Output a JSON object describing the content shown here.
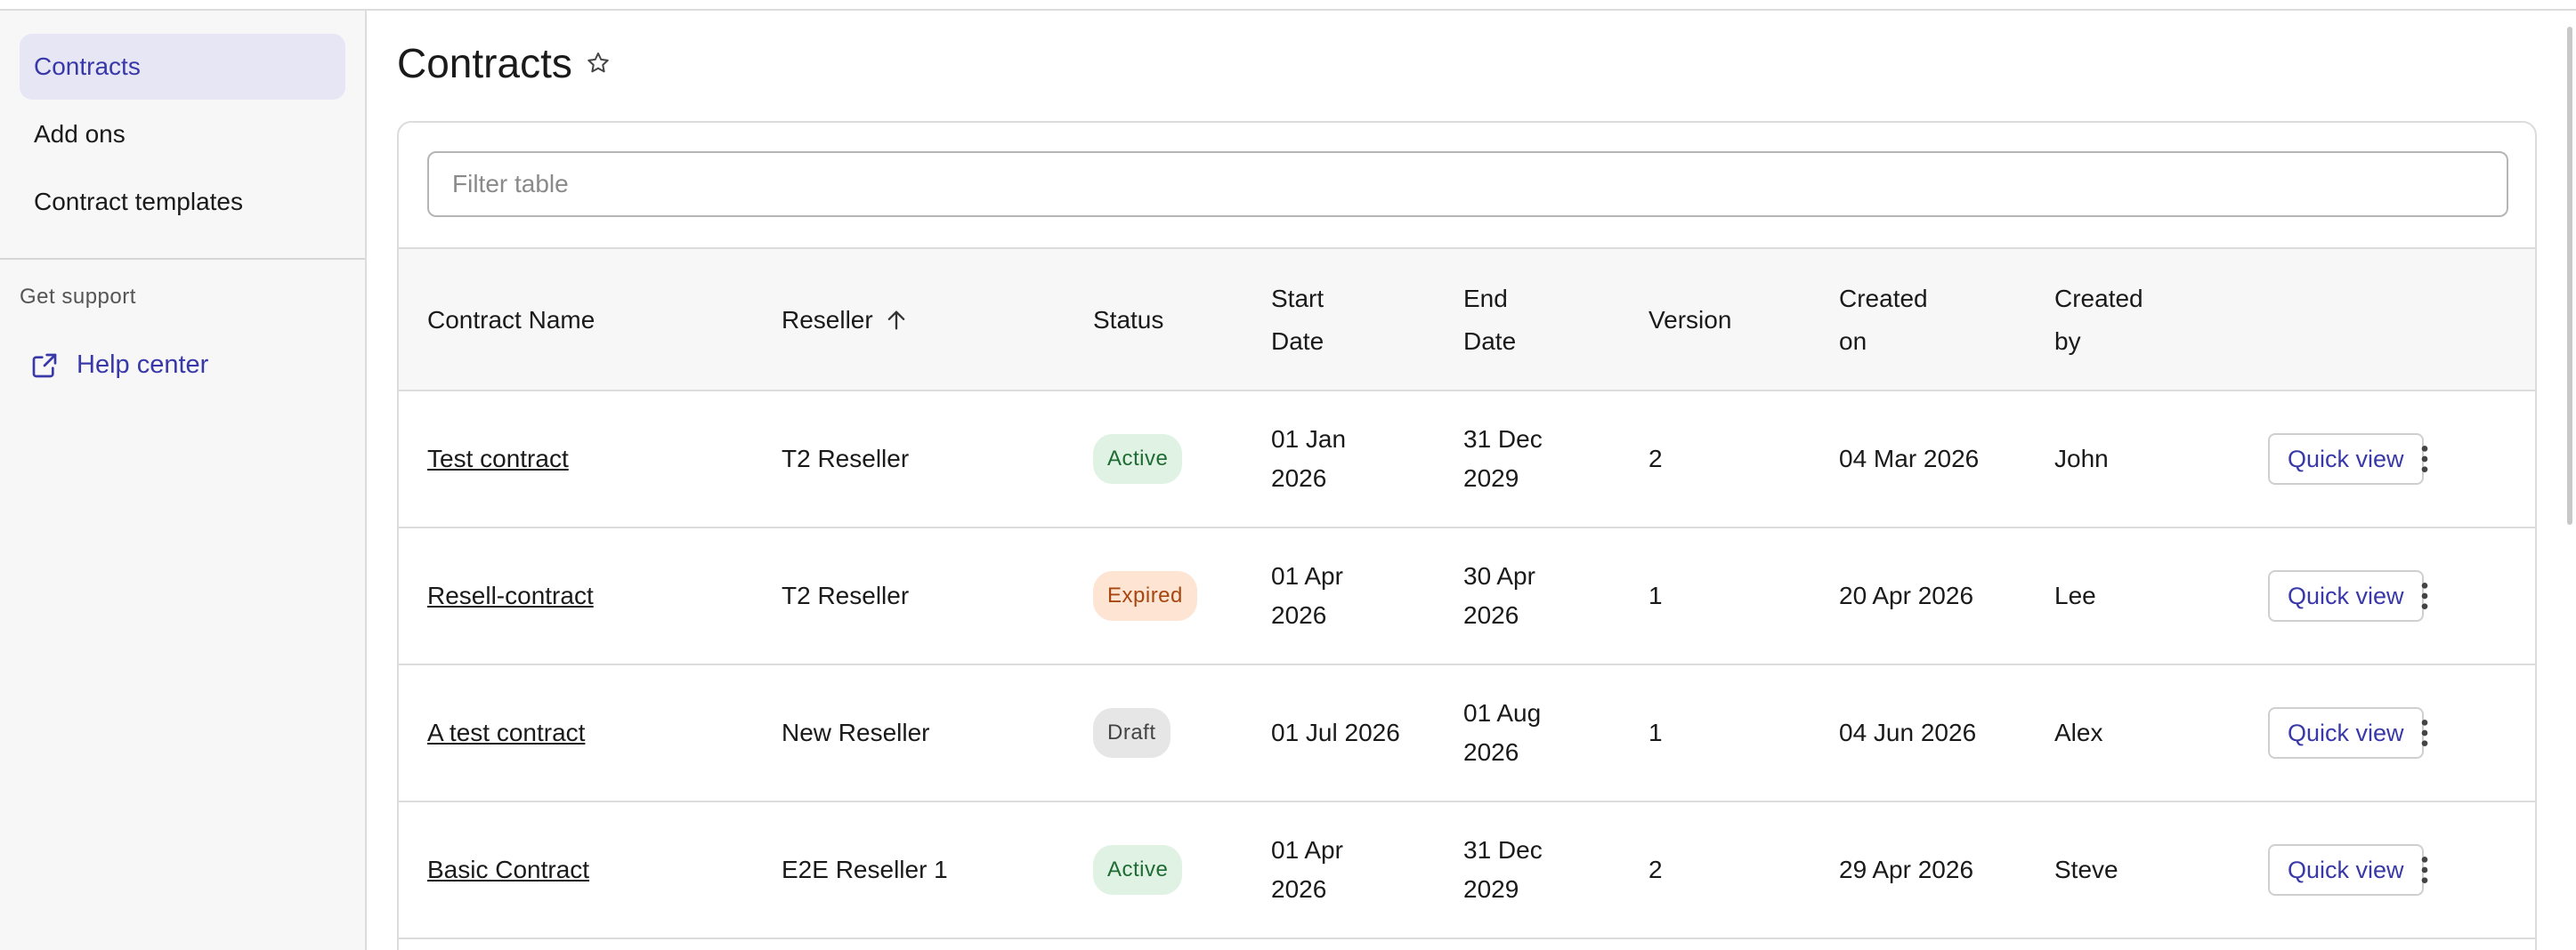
{
  "sidebar": {
    "items": [
      {
        "label": "Contracts"
      },
      {
        "label": "Add ons"
      },
      {
        "label": "Contract templates"
      }
    ],
    "support_heading": "Get support",
    "help_label": "Help center"
  },
  "page": {
    "title": "Contracts"
  },
  "filter": {
    "placeholder": "Filter table"
  },
  "table": {
    "headers": {
      "name": "Contract Name",
      "reseller": "Reseller",
      "status": "Status",
      "start_1": "Start",
      "start_2": "Date",
      "end_1": "End",
      "end_2": "Date",
      "version": "Version",
      "created_on_1": "Created",
      "created_on_2": "on",
      "created_by_1": "Created",
      "created_by_2": "by"
    },
    "rows": [
      {
        "name": "Test contract",
        "reseller": "T2 Reseller",
        "status": "Active",
        "start_1": "01 Jan",
        "start_2": "2026",
        "end_1": "31 Dec",
        "end_2": "2029",
        "version": "2",
        "created_on": "04 Mar 2026",
        "created_by": "John",
        "action": "Quick view"
      },
      {
        "name": "Resell-contract",
        "reseller": "T2 Reseller",
        "status": "Expired",
        "start_1": "01 Apr",
        "start_2": "2026",
        "end_1": "30 Apr",
        "end_2": "2026",
        "version": "1",
        "created_on": "20 Apr 2026",
        "created_by": "Lee",
        "action": "Quick view"
      },
      {
        "name": "A test contract",
        "reseller": "New Reseller",
        "status": "Draft",
        "start_1": "01 Jul 2026",
        "start_2": "",
        "end_1": "01 Aug",
        "end_2": "2026",
        "version": "1",
        "created_on": "04 Jun 2026",
        "created_by": "Alex",
        "action": "Quick view"
      },
      {
        "name": "Basic Contract",
        "reseller": "E2E Reseller 1",
        "status": "Active",
        "start_1": "01 Apr",
        "start_2": "2026",
        "end_1": "31 Dec",
        "end_2": "2029",
        "version": "2",
        "created_on": "29 Apr 2026",
        "created_by": "Steve",
        "action": "Quick view"
      }
    ]
  },
  "colors": {
    "accent": "#3838a8",
    "active_nav_bg": "#e6e6f5",
    "badge_active": "#1f6b33",
    "badge_expired": "#a8460f",
    "badge_draft": "#444444"
  },
  "icons": {
    "help": "external-link-icon",
    "title": "star-icon",
    "sort": "arrow-up-icon",
    "row_menu": "kebab-menu-icon"
  }
}
